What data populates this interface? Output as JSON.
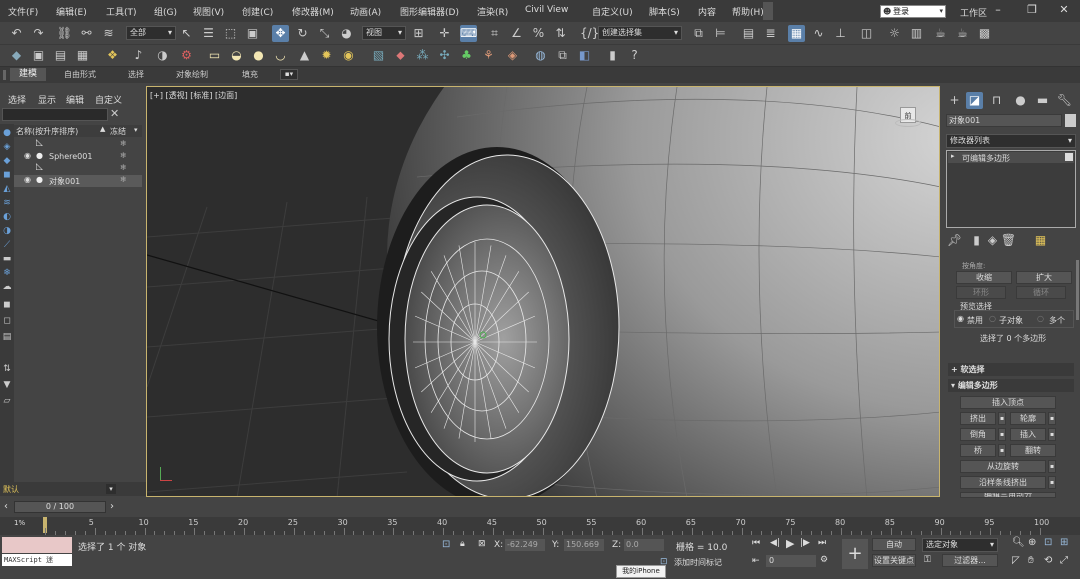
{
  "menu": {
    "items": [
      "文件(F)",
      "编辑(E)",
      "工具(T)",
      "组(G)",
      "视图(V)",
      "创建(C)",
      "修改器(M)",
      "动画(A)",
      "图形编辑器(D)",
      "渲染(R)",
      "Civil View",
      "自定义(U)",
      "脚本(S)",
      "内容",
      "帮助(H)"
    ],
    "login": "登录",
    "workspace": "工作区"
  },
  "toolbar": {
    "filter_dropdown": "全部",
    "ref_coord_dropdown": "视图",
    "selection_set_dropdown": "创建选择集"
  },
  "ribbon": {
    "tabs": [
      "建模",
      "自由形式",
      "选择",
      "对象绘制",
      "填充"
    ]
  },
  "explorer": {
    "menu": [
      "选择",
      "显示",
      "编辑",
      "自定义"
    ],
    "col_name": "名称(按升序排序)",
    "col_freeze": "冻结",
    "rows": [
      "",
      "Sphere001",
      "",
      "对象001"
    ]
  },
  "viewport": {
    "label": "[+] [透视] [标准] [边面]",
    "viewcube_label": "前"
  },
  "command_panel": {
    "object_name": "对象001",
    "modifier_list": "修改器列表",
    "stack_item": "可编辑多边形",
    "by_vertex": "按角度:",
    "shrink": "收缩",
    "grow": "扩大",
    "ring": "环形",
    "loop": "循环",
    "preview_title": "预览选择",
    "preview_disabled": "禁用",
    "preview_subobj": "子对象",
    "preview_multi": "多个",
    "selection_status": "选择了 0 个多边形",
    "soft_selection": "软选择",
    "edit_poly": "编辑多边形",
    "insert_vertex": "插入顶点",
    "extrude": "挤出",
    "outline": "轮廓",
    "bevel": "倒角",
    "inset": "插入",
    "bridge": "桥",
    "flip": "翻转",
    "hinge": "从边旋转",
    "extrude_spline": "沿样条线挤出",
    "edit_triangulation": "编辑三角剖分"
  },
  "bottom": {
    "default_layer": "默认",
    "time_slider": "0 / 100",
    "frame_ticks": [
      "5",
      "10",
      "15",
      "20",
      "25",
      "30",
      "35",
      "40",
      "45",
      "50",
      "55",
      "60",
      "65",
      "70",
      "75",
      "80",
      "85",
      "90",
      "95",
      "100"
    ],
    "maxscript": "MAXScript 迷",
    "status_text": "选择了 1 个 对象",
    "coord_x_label": "X:",
    "coord_x": "-62.249",
    "coord_y_label": "Y:",
    "coord_y": "150.669",
    "coord_z_label": "Z:",
    "coord_z": "0.0",
    "grid": "栅格 = 10.0",
    "add_time_tag": "添加时间标记",
    "iphone_tooltip": "我的iPhone",
    "auto_key": "自动",
    "set_key": "设置关键点",
    "selected_object": "选定对象",
    "filter_btn": "过滤器...",
    "frame_field": "0",
    "percent_label": "1%"
  }
}
